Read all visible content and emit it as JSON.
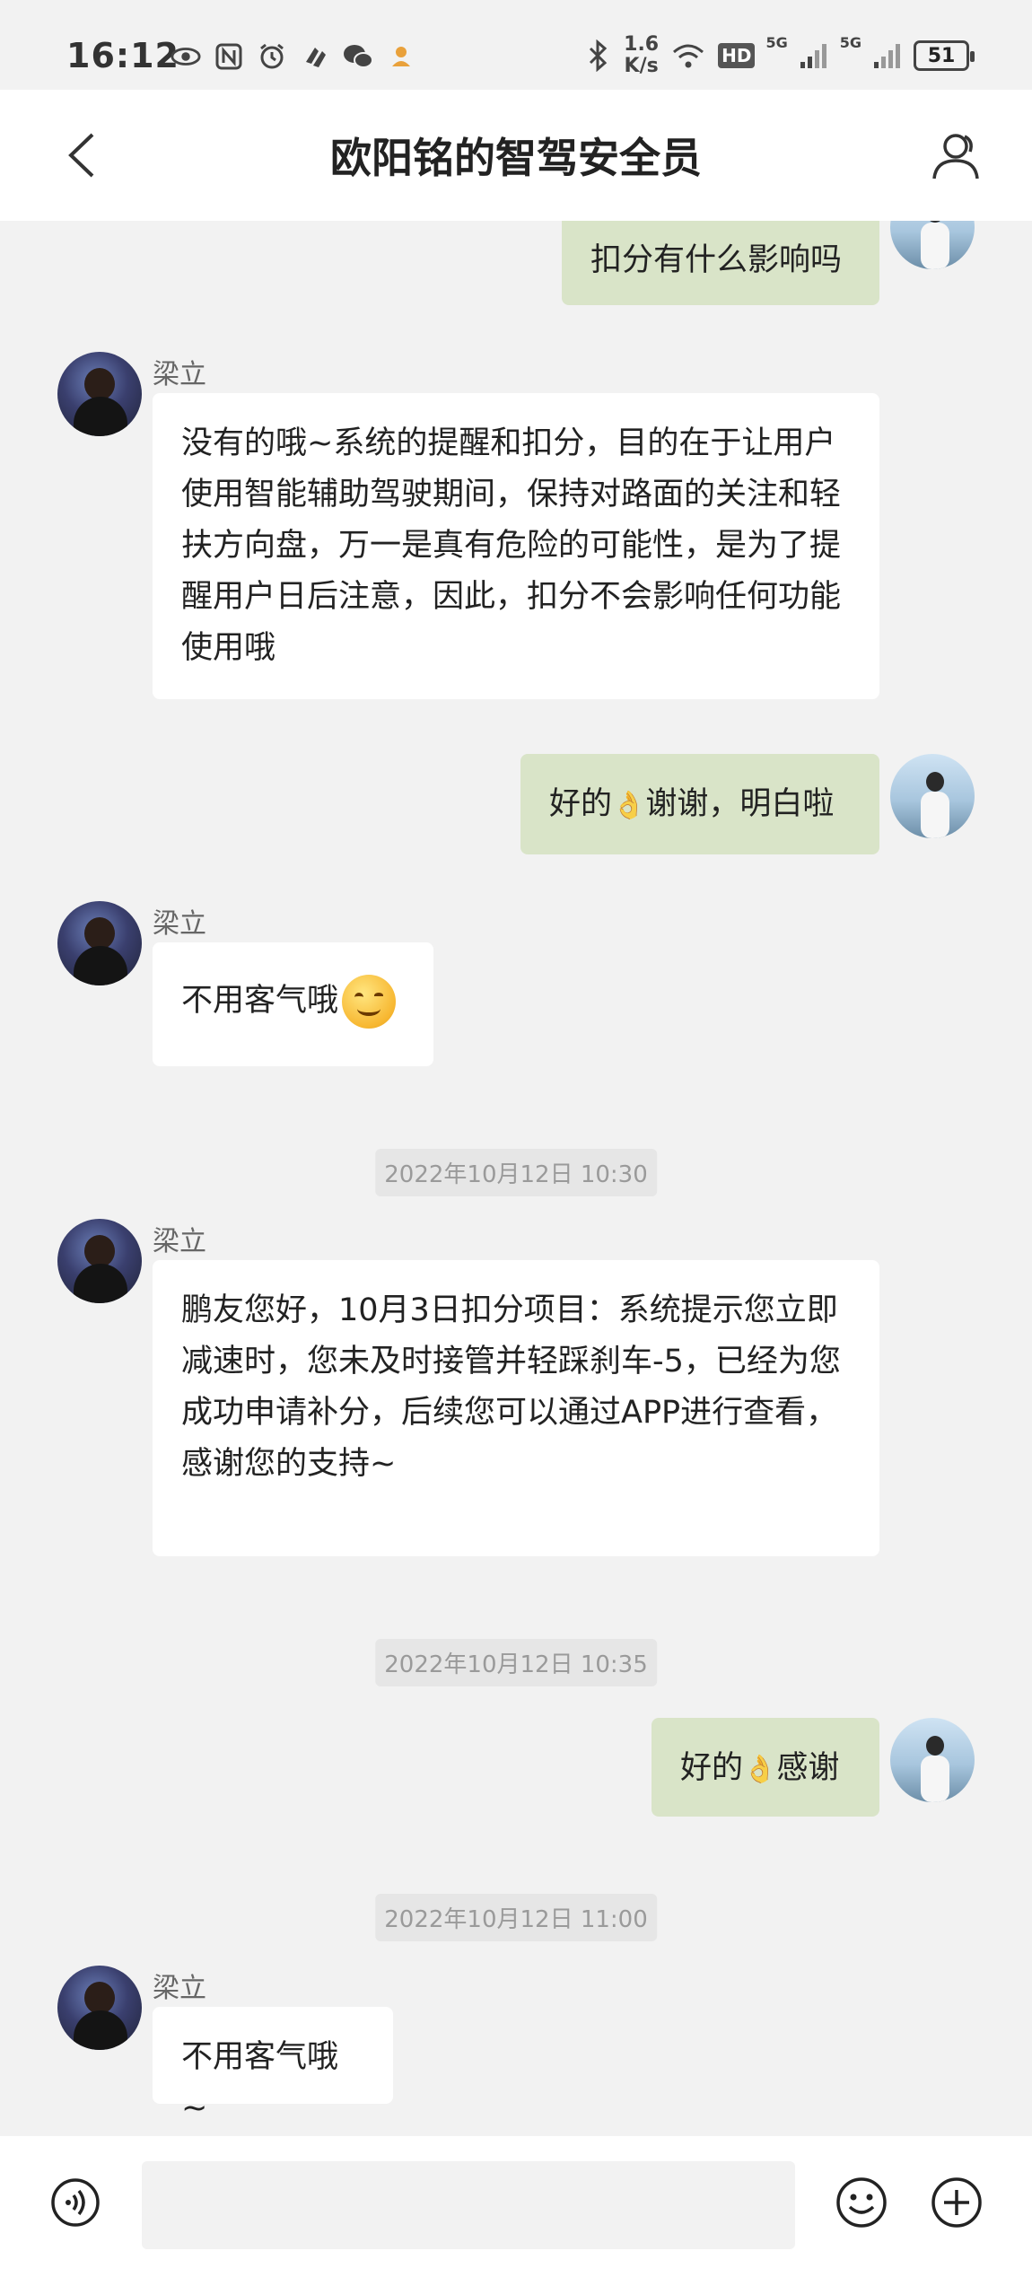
{
  "status_bar": {
    "time": "16:12",
    "net_speed_value": "1.6",
    "net_speed_unit": "K/s",
    "hd_label": "HD",
    "signal_label_1": "5G",
    "signal_label_2": "5G",
    "battery": "51",
    "left_icons": [
      "eye-icon",
      "nfc-icon",
      "alarm-icon",
      "link-icon",
      "wechat-icon",
      "app-icon"
    ]
  },
  "header": {
    "title": "欧阳铭的智驾安全员"
  },
  "messages": [
    {
      "type": "self",
      "text": "扣分有什么影响吗"
    },
    {
      "type": "other",
      "sender": "梁立",
      "text": "没有的哦~系统的提醒和扣分，目的在于让用户使用智能辅助驾驶期间，保持对路面的关注和轻扶方向盘，万一是真有危险的可能性，是为了提醒用户日后注意，因此，扣分不会影响任何功能使用哦"
    },
    {
      "type": "self",
      "text_before": "好的",
      "emoji": "👌",
      "text_after": "谢谢，明白啦"
    },
    {
      "type": "other",
      "sender": "梁立",
      "text": "不用客气哦",
      "emoji": "smiley-emoji"
    },
    {
      "type": "timestamp",
      "text": "2022年10月12日 10:30"
    },
    {
      "type": "other",
      "sender": "梁立",
      "text": "鹏友您好，10月3日扣分项目：系统提示您立即减速时，您未及时接管并轻踩刹车-5，已经为您成功申请补分，后续您可以通过APP进行查看，感谢您的支持~"
    },
    {
      "type": "timestamp",
      "text": "2022年10月12日 10:35"
    },
    {
      "type": "self",
      "text_before": "好的",
      "emoji": "👌",
      "text_after": "感谢"
    },
    {
      "type": "timestamp",
      "text": "2022年10月12日 11:00"
    },
    {
      "type": "other",
      "sender": "梁立",
      "text": "不用客气哦~"
    }
  ],
  "input_bar": {
    "placeholder": ""
  },
  "colors": {
    "background": "#f2f2f2",
    "self_bubble": "#d9e4c8",
    "other_bubble": "#ffffff",
    "header_bg": "#ffffff"
  }
}
